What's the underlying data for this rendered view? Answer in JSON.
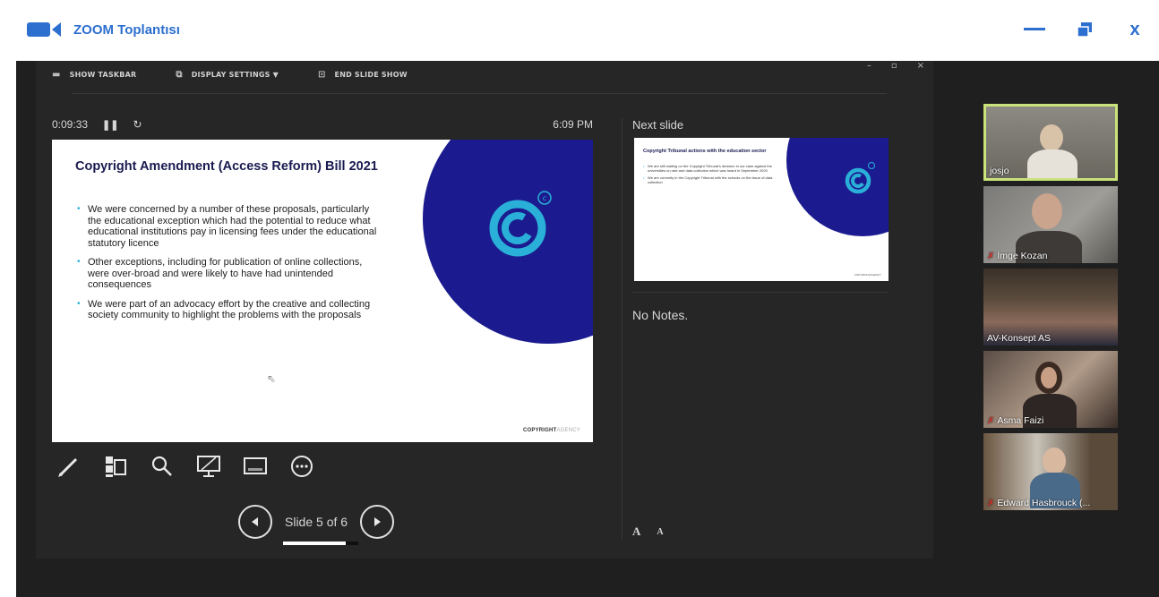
{
  "titlebar": {
    "title": "ZOOM Toplantısı",
    "icon": "camera-icon",
    "controls": [
      "minimize-icon",
      "restore-icon",
      "close-icon"
    ],
    "close_label": "x",
    "accent": "#2d6fcf"
  },
  "presenter": {
    "toolbar": {
      "show_taskbar": "SHOW TASKBAR",
      "display_settings": "DISPLAY SETTINGS ▼",
      "end_slide_show": "END SLIDE SHOW"
    },
    "window_controls": [
      "–",
      "▫",
      "×"
    ],
    "timer": "0:09:33",
    "clock": "6:09 PM",
    "slide": {
      "title": "Copyright Amendment (Access Reform) Bill 2021",
      "bullets": [
        "We were concerned by a number of these proposals, particularly the educational exception which had the potential to reduce what educational institutions pay in licensing fees under the educational statutory licence",
        "Other exceptions, including for publication of online collections, were over-broad and were likely to have had unintended consequences",
        "We were part of an advocacy effort by the creative and collecting society community to highlight the problems with the proposals"
      ],
      "footer_bold": "COPYRIGHT",
      "footer_light": "AGENCY",
      "brand_color": "#1b1b8f",
      "accent_color": "#2ab0d8"
    },
    "tools": [
      "pen-icon",
      "slide-grid-icon",
      "zoom-icon",
      "screen-pointer-icon",
      "subtitles-icon",
      "more-options-icon"
    ],
    "navigation": {
      "label": "Slide 5 of 6",
      "progress": 0.83
    },
    "next_slide": {
      "heading": "Next slide",
      "title": "Copyright Tribunal actions with the education sector",
      "bullets": [
        "We are still waiting on the Copyright Tribunal's decision in our case against the universities on rate and data collection which was heard in September 2020",
        "We are currently in the Copyright Tribunal with the schools on the issue of data collection"
      ],
      "footer": "COPYRIGHTAGENCY"
    },
    "notes": "No Notes.",
    "font_buttons": [
      "A",
      "A"
    ]
  },
  "participants": [
    {
      "name": "josjo",
      "active": true,
      "muted": false
    },
    {
      "name": "İmge Kozan",
      "active": false,
      "muted": true
    },
    {
      "name": "AV-Konsept AS",
      "active": false,
      "muted": false
    },
    {
      "name": "Asma Faizi",
      "active": false,
      "muted": true
    },
    {
      "name": "Edward Hasbrouck (...",
      "active": false,
      "muted": true
    }
  ]
}
